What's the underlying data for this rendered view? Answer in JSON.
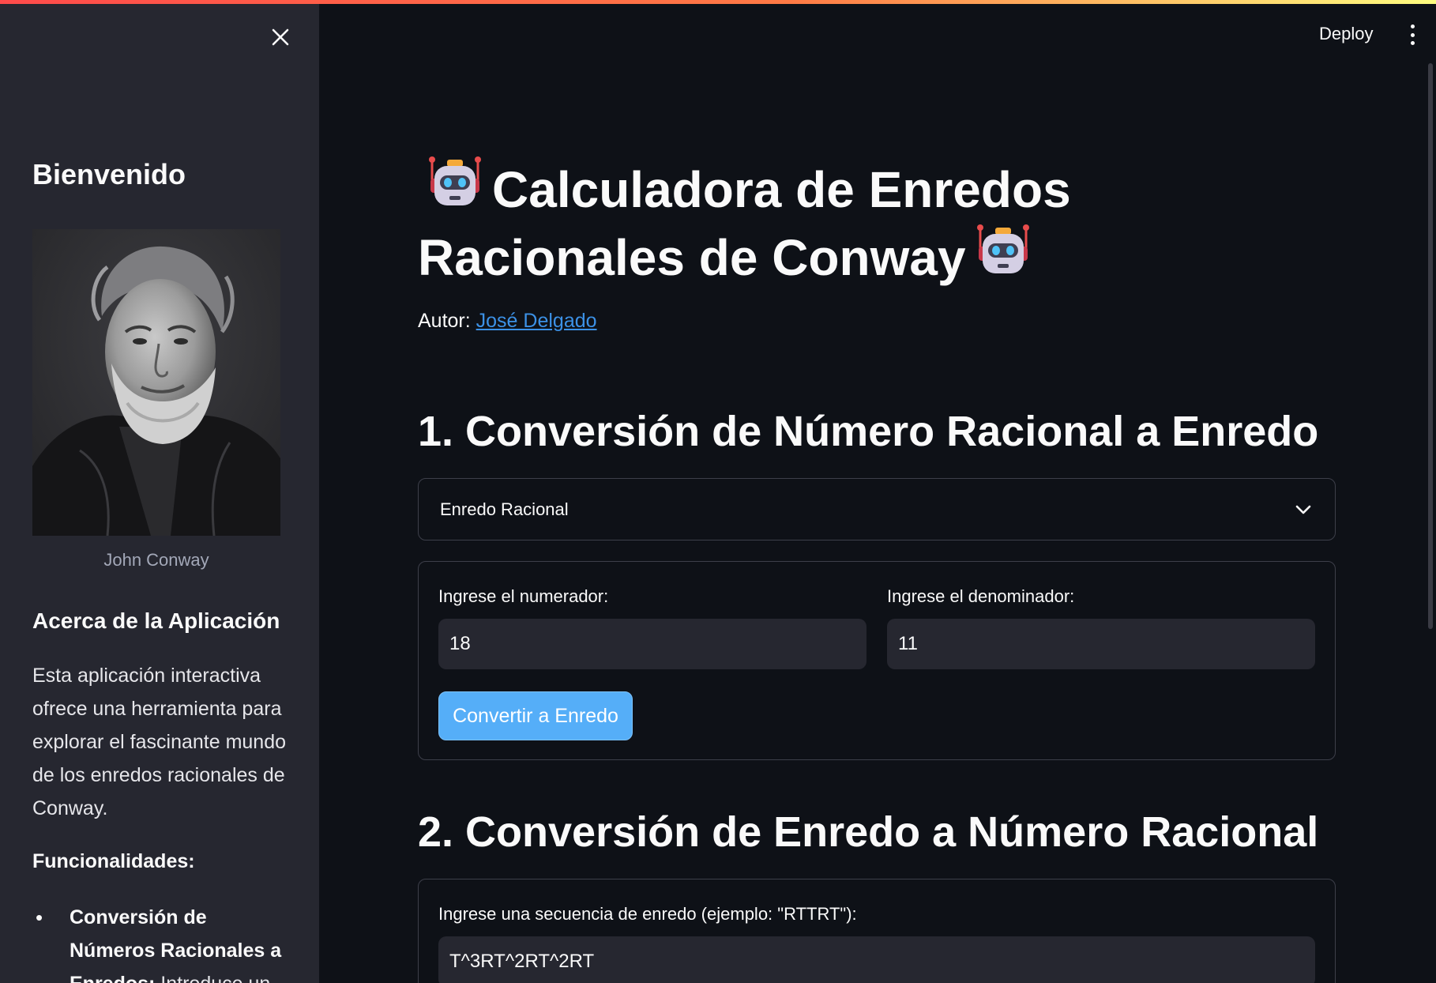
{
  "sidebar": {
    "title": "Bienvenido",
    "image_caption": "John Conway",
    "about_heading": "Acerca de la Aplicación",
    "about_text": "Esta aplicación interactiva ofrece una herramienta para explorar el fascinante mundo de los enredos racionales de Conway.",
    "features_heading": "Funcionalidades:",
    "features": [
      {
        "bold": "Conversión de Números Racionales a Enredos:",
        "text": " Introduce un"
      }
    ]
  },
  "header": {
    "deploy_label": "Deploy"
  },
  "main": {
    "title": "Calculadora de Enredos Racionales de Conway",
    "author_prefix": "Autor:",
    "author_name": "José Delgado",
    "section1": {
      "heading": "1. Conversión de Número Racional a Enredo",
      "select_value": "Enredo Racional",
      "numerator_label": "Ingrese el numerador:",
      "numerator_value": "18",
      "denominator_label": "Ingrese el denominador:",
      "denominator_value": "11",
      "button_label": "Convertir a Enredo"
    },
    "section2": {
      "heading": "2. Conversión de Enredo a Número Racional",
      "sequence_label": "Ingrese una secuencia de enredo (ejemplo: \"RTTRT\"):",
      "sequence_value": "T^3RT^2RT^2RT"
    }
  },
  "colors": {
    "background": "#0e1117",
    "sidebar": "#262730",
    "primary_button": "#55aef8",
    "link": "#3c91e6"
  },
  "icons": [
    "close-icon",
    "robot-icon",
    "chevron-down-icon",
    "kebab-menu-icon"
  ]
}
